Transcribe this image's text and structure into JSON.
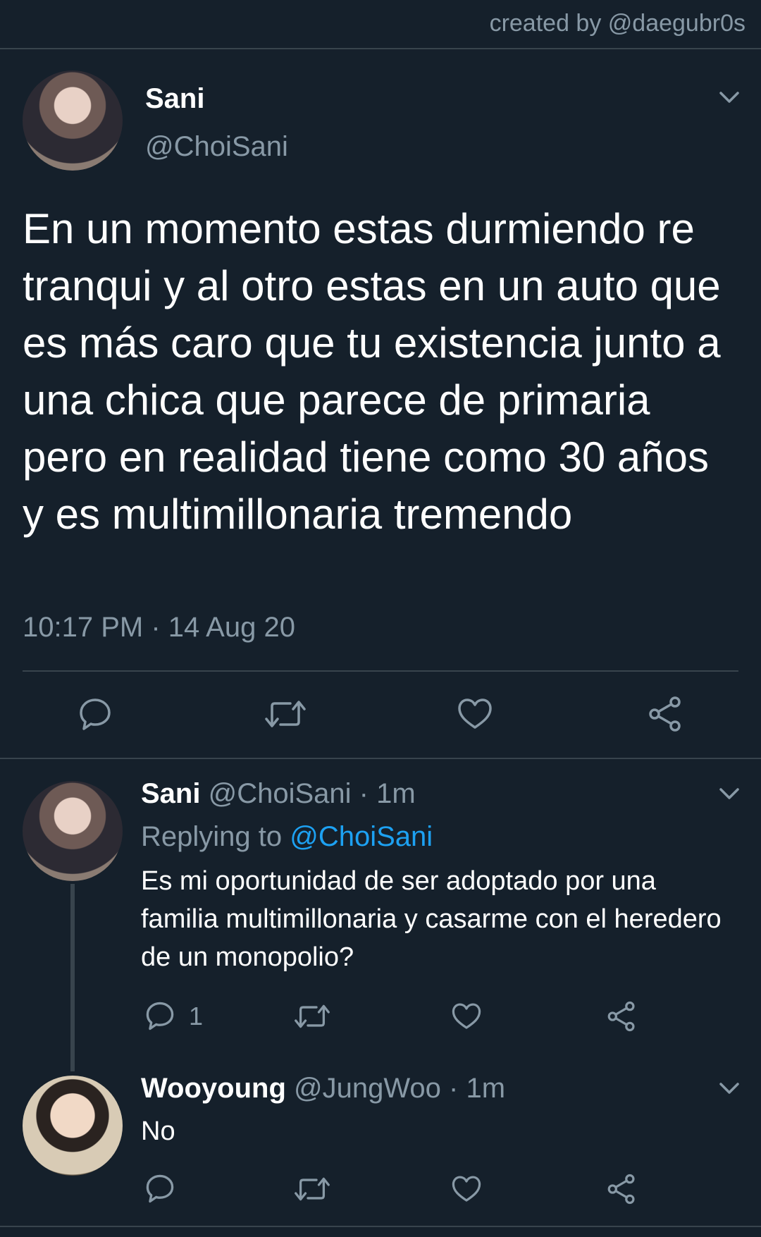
{
  "credit": "created by @daegubr0s",
  "main_tweet": {
    "name": "Sani",
    "handle": "@ChoiSani",
    "text": "En un momento estas durmiendo re tranqui y al otro estas en un auto que es más caro que tu existencia junto a una chica que parece de primaria pero en realidad tiene como 30 años y es multimillonaria tremendo",
    "timestamp": "10:17 PM · 14 Aug 20"
  },
  "replies": [
    {
      "name": "Sani",
      "handle": "@ChoiSani",
      "time": "· 1m",
      "replying_label": "Replying to",
      "replying_to": "@ChoiSani",
      "text": "Es mi oportunidad de ser adoptado por una familia multimillonaria y casarme con el heredero de un monopolio?",
      "reply_count": "1"
    },
    {
      "name": "Wooyoung",
      "handle": "@JungWoo",
      "time": "· 1m",
      "text": "No"
    }
  ],
  "colors": {
    "background": "#15202b",
    "secondary_text": "#8899a6",
    "link": "#1da1f2",
    "divider": "#38444d"
  },
  "icons": [
    "chevron-down-icon",
    "reply-icon",
    "retweet-icon",
    "like-icon",
    "share-icon"
  ]
}
